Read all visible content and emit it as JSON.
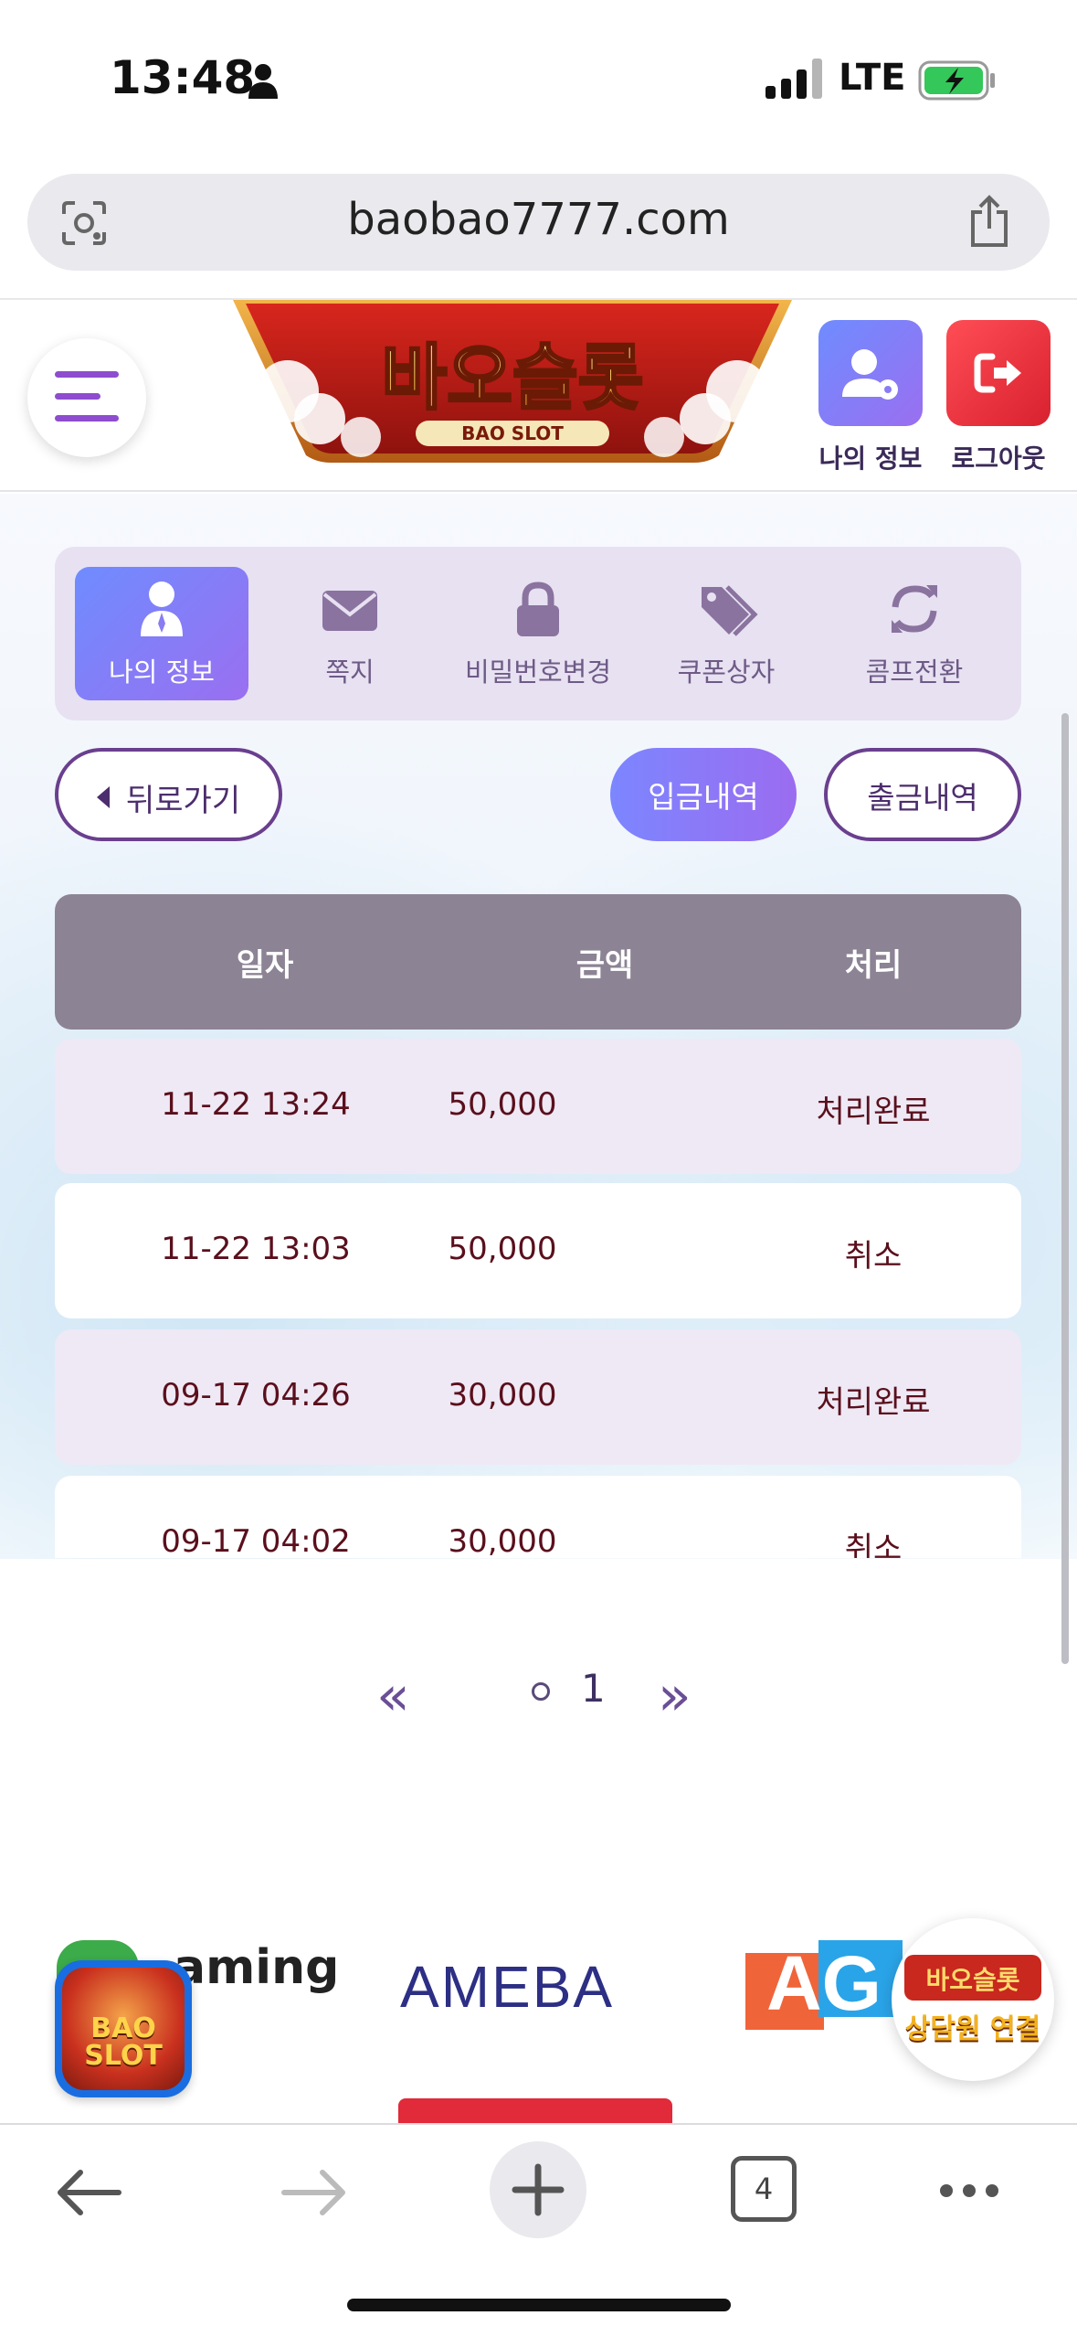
{
  "status_bar": {
    "time": "13:48",
    "network": "LTE",
    "battery_color": "#34c759"
  },
  "browser": {
    "url": "baobao7777.com",
    "tab_count": "4"
  },
  "header": {
    "logo_text": "바오슬롯",
    "logo_sub": "BAO SLOT",
    "my_info_label": "나의 정보",
    "logout_label": "로그아웃",
    "colors": {
      "my_info": "#7b6cf2",
      "logout": "#e8323f",
      "menu": "#8e4dcf"
    }
  },
  "tabs": [
    {
      "label": "나의 정보",
      "icon": "user-icon",
      "active": true
    },
    {
      "label": "쪽지",
      "icon": "envelope-icon",
      "active": false
    },
    {
      "label": "비밀번호변경",
      "icon": "lock-icon",
      "active": false
    },
    {
      "label": "쿠폰상자",
      "icon": "tags-icon",
      "active": false
    },
    {
      "label": "콤프전환",
      "icon": "sync-icon",
      "active": false
    }
  ],
  "actions": {
    "back": "뒤로가기",
    "deposit_history": "입금내역",
    "withdraw_history": "출금내역"
  },
  "table": {
    "headers": {
      "date": "일자",
      "amount": "금액",
      "status": "처리"
    },
    "rows": [
      {
        "date": "11-22 13:24",
        "amount": "50,000",
        "status": "처리완료"
      },
      {
        "date": "11-22 13:03",
        "amount": "50,000",
        "status": "취소"
      },
      {
        "date": "09-17 04:26",
        "amount": "30,000",
        "status": "처리완료"
      },
      {
        "date": "09-17 04:02",
        "amount": "30,000",
        "status": "취소"
      }
    ]
  },
  "pagination": {
    "prev": "«",
    "current": "1",
    "next": "»"
  },
  "partners": {
    "gaming": "aming",
    "ameba": "AMEBA",
    "ag": "AG"
  },
  "floating": {
    "left_badge_line1": "BAO",
    "left_badge_line2": "SLOT",
    "right_badge_top": "바오슬롯",
    "right_badge_bottom": "상담원 연결"
  }
}
